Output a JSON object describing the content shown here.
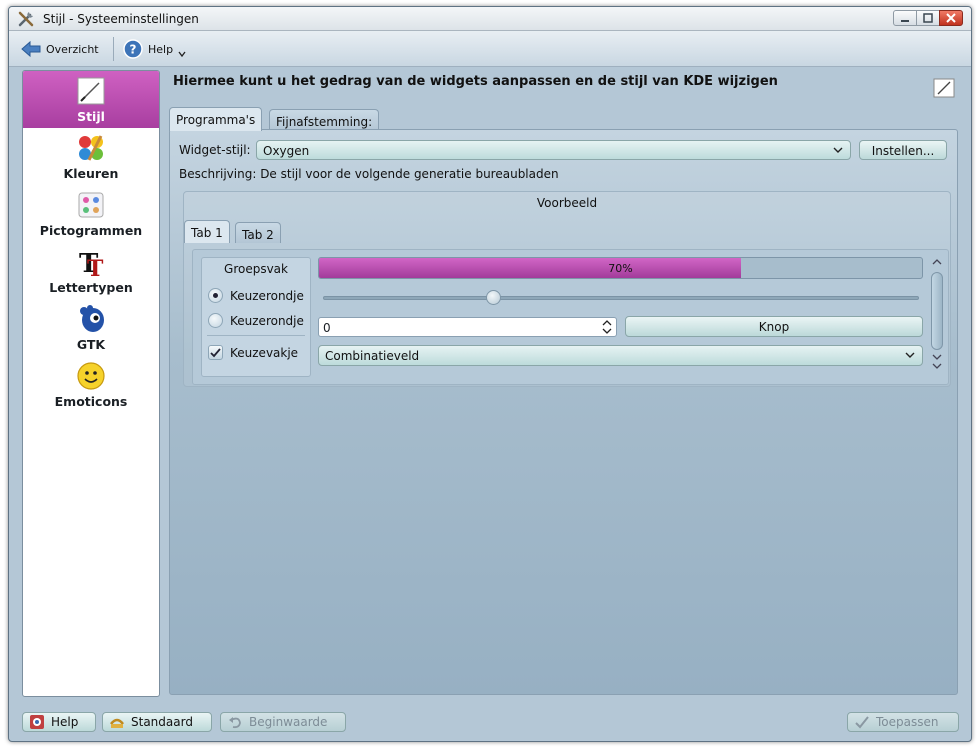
{
  "window": {
    "title": "Stijl - Systeeminstellingen"
  },
  "toolbar": {
    "overview_label": "Overzicht",
    "help_label": "Help"
  },
  "sidebar": {
    "items": [
      {
        "label": "Stijl",
        "icon": "style-icon",
        "active": true
      },
      {
        "label": "Kleuren",
        "icon": "colors-icon",
        "active": false
      },
      {
        "label": "Pictogrammen",
        "icon": "icons-icon",
        "active": false
      },
      {
        "label": "Lettertypen",
        "icon": "fonts-icon",
        "active": false
      },
      {
        "label": "GTK",
        "icon": "gtk-icon",
        "active": false
      },
      {
        "label": "Emoticons",
        "icon": "emoticons-icon",
        "active": false
      }
    ]
  },
  "header": {
    "text": "Hiermee kunt u het gedrag van de widgets aanpassen en de stijl van KDE wijzigen"
  },
  "tabs": {
    "programs": "Programma's",
    "finetune": "Fijnafstemming:"
  },
  "widget_style": {
    "label": "Widget-stijl:",
    "value": "Oxygen",
    "configure_button": "Instellen..."
  },
  "description": {
    "text": "Beschrijving: De stijl voor de volgende generatie bureaubladen"
  },
  "preview": {
    "title": "Voorbeeld",
    "tabs": [
      "Tab 1",
      "Tab 2"
    ],
    "group_title": "Groepsvak",
    "radio1_label": "Keuzerondje",
    "radio2_label": "Keuzerondje",
    "checkbox_label": "Keuzevakje",
    "progress_value": 0.7,
    "progress_text": "70%",
    "spin_value": "0",
    "button_label": "Knop",
    "combo_value": "Combinatieveld",
    "slider_value": 0.3
  },
  "bottom": {
    "help": "Help",
    "default": "Standaard",
    "reset": "Beginwaarde",
    "apply": "Toepassen"
  },
  "colors": {
    "accent": "#b94aae",
    "window_bg": "#b4c7d6"
  }
}
